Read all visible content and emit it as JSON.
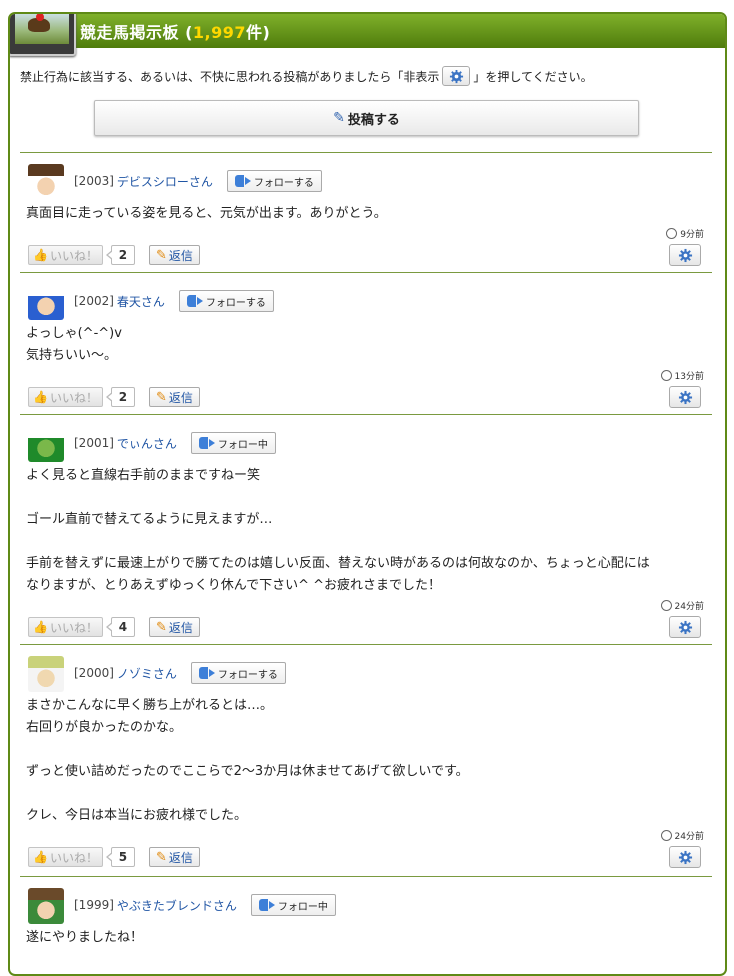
{
  "header": {
    "title": "競走馬掲示板",
    "count_open": "(",
    "count": "1,997",
    "count_close": "件)"
  },
  "notice": {
    "before": "禁止行為に該当する、あるいは、不快に思われる投稿がありましたら「非表示",
    "after": "」を押してください。"
  },
  "post_button": {
    "label": "投稿する"
  },
  "posts": [
    {
      "no": "[2003]",
      "name": "デビスシローさん",
      "follow": "フォローする",
      "lines": [
        "真面目に走っている姿を見ると、元気が出ます。ありがとう。"
      ],
      "time": "9分前",
      "like_label": "いいね！",
      "likes": "2",
      "reply": "返信"
    },
    {
      "no": "[2002]",
      "name": "春天さん",
      "follow": "フォローする",
      "lines": [
        "よっしゃ(^-^)v",
        "気持ちいい～。"
      ],
      "time": "13分前",
      "like_label": "いいね！",
      "likes": "2",
      "reply": "返信"
    },
    {
      "no": "[2001]",
      "name": "でぃんさん",
      "follow": "フォロー中",
      "lines": [
        "よく見ると直線右手前のままですねー笑",
        "",
        "ゴール直前で替えてるように見えますが…",
        "",
        "手前を替えずに最速上がりで勝てたのは嬉しい反面、替えない時があるのは何故なのか、ちょっと心配には",
        "なりますが、とりあえずゆっくり休んで下さい^ ^お疲れさまでした！"
      ],
      "time": "24分前",
      "like_label": "いいね！",
      "likes": "4",
      "reply": "返信"
    },
    {
      "no": "[2000]",
      "name": "ノゾミさん",
      "follow": "フォローする",
      "lines": [
        "まさかこんなに早く勝ち上がれるとは…。",
        "右回りが良かったのかな。",
        "",
        "ずっと使い詰めだったのでここらで2～3か月は休ませてあげて欲しいです。",
        "",
        "クレ、今日は本当にお疲れ様でした。"
      ],
      "time": "24分前",
      "like_label": "いいね！",
      "likes": "5",
      "reply": "返信"
    },
    {
      "no": "[1999]",
      "name": "やぶきたブレンドさん",
      "follow": "フォロー中",
      "lines": [
        "遂にやりましたね！"
      ],
      "time": "",
      "like_label": "",
      "likes": "",
      "reply": ""
    }
  ]
}
